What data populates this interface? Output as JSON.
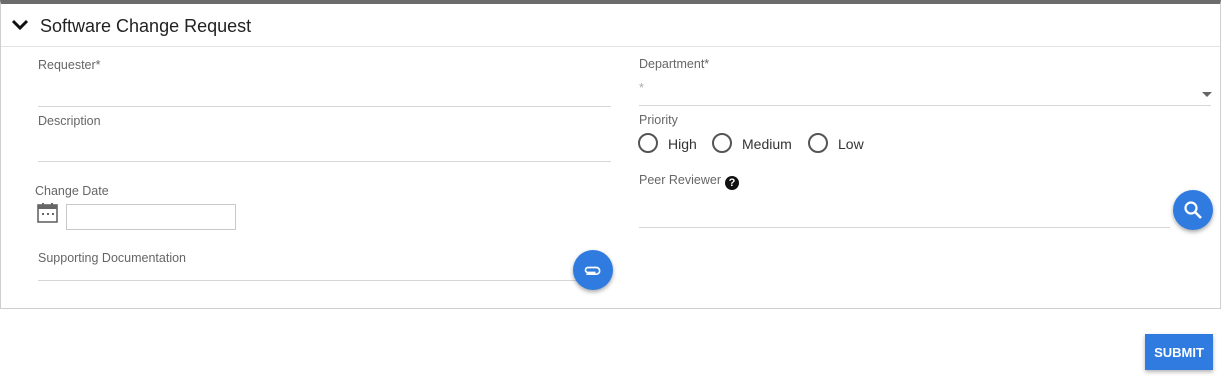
{
  "panel": {
    "title": "Software Change Request"
  },
  "form": {
    "requester_label": "Requester*",
    "description_label": "Description",
    "change_date_label": "Change Date",
    "supporting_doc_label": "Supporting Documentation",
    "department_label": "Department*",
    "department_value": "*",
    "priority_label": "Priority",
    "priority_options": [
      "High",
      "Medium",
      "Low"
    ],
    "peer_reviewer_label": "Peer Reviewer",
    "help_glyph": "?"
  },
  "actions": {
    "submit_label": "SUBMIT"
  },
  "colors": {
    "accent": "#2f7be0",
    "header_bar": "#6b6b6b"
  },
  "icons": [
    "chevron-down-icon",
    "calendar-icon",
    "paperclip-icon",
    "search-icon",
    "help-icon"
  ]
}
